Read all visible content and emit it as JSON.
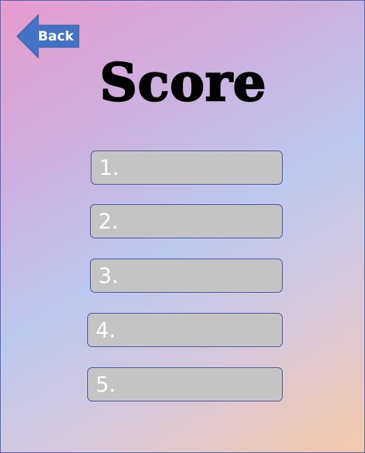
{
  "navigation": {
    "back_label": "Back",
    "back_color": "#4472c4"
  },
  "header": {
    "title": "Score"
  },
  "scoreboard": {
    "slots": [
      {
        "rank": "1.",
        "value": ""
      },
      {
        "rank": "2.",
        "value": ""
      },
      {
        "rank": "3.",
        "value": ""
      },
      {
        "rank": "4.",
        "value": ""
      },
      {
        "rank": "5.",
        "value": ""
      }
    ],
    "slot_color": "#c4c4c4",
    "border_color": "#3f4f9a"
  }
}
